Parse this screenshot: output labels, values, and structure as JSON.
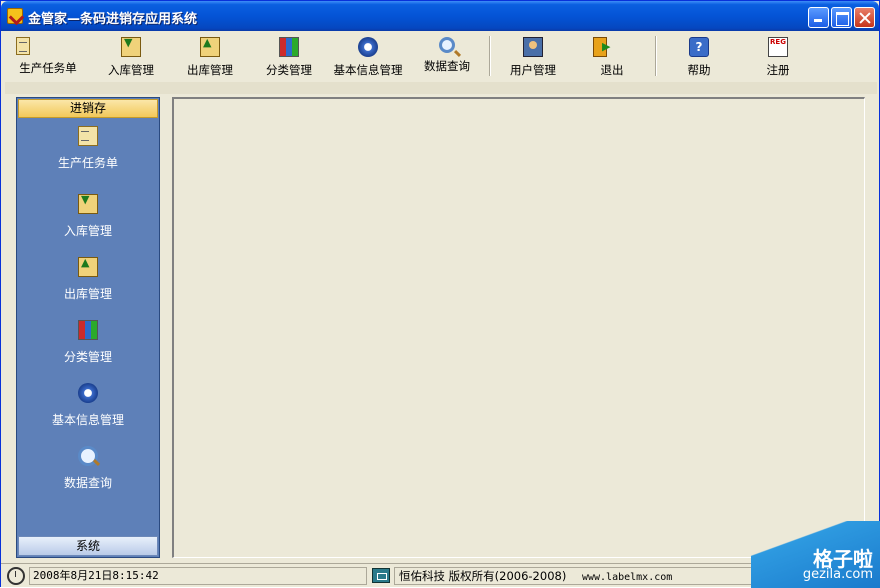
{
  "window": {
    "title": "金管家—条码进销存应用系统"
  },
  "toolbar": {
    "items": [
      {
        "label": "生产任务单",
        "icon": "task-doc-icon"
      },
      {
        "label": "入库管理",
        "icon": "stock-in-icon"
      },
      {
        "label": "出库管理",
        "icon": "stock-out-icon"
      },
      {
        "label": "分类管理",
        "icon": "category-icon"
      },
      {
        "label": "基本信息管理",
        "icon": "gear-icon"
      },
      {
        "label": "数据查询",
        "icon": "search-icon"
      },
      {
        "label": "用户管理",
        "icon": "user-icon"
      },
      {
        "label": "退出",
        "icon": "exit-door-icon"
      },
      {
        "label": "帮助",
        "icon": "help-icon"
      },
      {
        "label": "注册",
        "icon": "register-icon"
      }
    ]
  },
  "sidebar": {
    "header": "进销存",
    "items": [
      {
        "label": "生产任务单"
      },
      {
        "label": "入库管理"
      },
      {
        "label": "出库管理"
      },
      {
        "label": "分类管理"
      },
      {
        "label": "基本信息管理"
      },
      {
        "label": "数据查询"
      }
    ],
    "footer": "系统"
  },
  "status": {
    "datetime": "2008年8月21日8:15:42",
    "copyright": "恒佑科技 版权所有(2006-2008)",
    "url": "www.labelmx.com"
  },
  "watermark": {
    "cn": "格子啦",
    "en": "gezila.com"
  }
}
